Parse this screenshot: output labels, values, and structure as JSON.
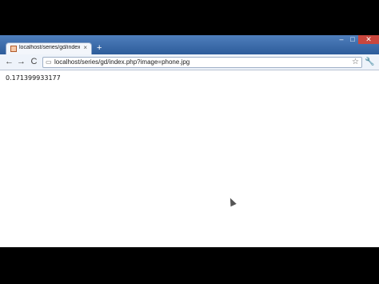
{
  "tab": {
    "title": "localhost/series/gd/index...",
    "close": "×"
  },
  "new_tab": "+",
  "window_controls": {
    "minimize": "–",
    "maximize": "□",
    "close": "✕"
  },
  "nav": {
    "back": "←",
    "forward": "→",
    "reload": "C"
  },
  "address_bar": {
    "url": "localhost/series/gd/index.php?image=phone.jpg"
  },
  "icons": {
    "page": "page-icon",
    "star": "star-icon",
    "wrench": "wrench-icon"
  },
  "page": {
    "output": "0.171399933177"
  }
}
